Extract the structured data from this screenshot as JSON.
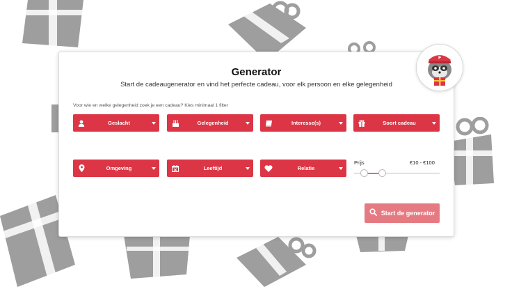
{
  "generator": {
    "title": "Generator",
    "subtitle": "Start de cadeaugenerator en vind het perfecte cadeau, voor elk persoon en elke gelegenheid",
    "hint": "Voor wie en welke gelegenheid zoek je een cadeau? Kies minimaal 1 filter",
    "filters_row1": [
      {
        "label": "Geslacht",
        "icon": "person-icon"
      },
      {
        "label": "Gelegenheid",
        "icon": "cake-icon"
      },
      {
        "label": "Interesse(s)",
        "icon": "book-icon"
      },
      {
        "label": "Soort cadeau",
        "icon": "gift-icon"
      }
    ],
    "filters_row2": [
      {
        "label": "Omgeving",
        "icon": "location-pin-icon"
      },
      {
        "label": "Leeftijd",
        "icon": "calendar-icon"
      },
      {
        "label": "Relatie",
        "icon": "heart-icon"
      }
    ],
    "price": {
      "label": "Prijs",
      "range_text": "€10 - €100",
      "min_fraction": 0.12,
      "max_fraction": 0.33
    },
    "start_button": "Start de generator"
  },
  "colors": {
    "button_red": "#dc3545",
    "start_button_pink": "#e67a82",
    "background_gift_gray": "#9e9e9e"
  },
  "mascot": {
    "icon": "raccoon-mascot-icon"
  }
}
